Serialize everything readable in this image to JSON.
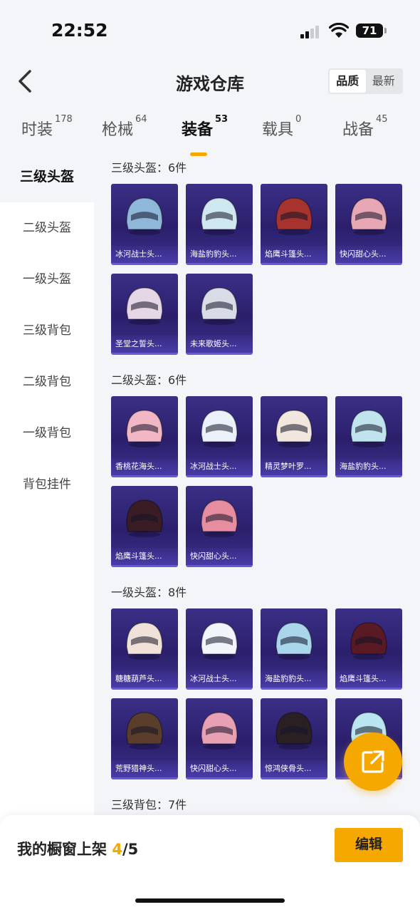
{
  "status_bar": {
    "time": "22:52",
    "battery": "71"
  },
  "header": {
    "title": "游戏仓库",
    "sort_options": [
      "品质",
      "最新"
    ],
    "sort_selected": "品质"
  },
  "tabs": [
    {
      "label": "时装",
      "count": "178"
    },
    {
      "label": "枪械",
      "count": "64"
    },
    {
      "label": "装备",
      "count": "53"
    },
    {
      "label": "载具",
      "count": "0"
    },
    {
      "label": "战备",
      "count": "45"
    }
  ],
  "active_tab": "装备",
  "sidebar": {
    "items": [
      "三级头盔",
      "二级头盔",
      "一级头盔",
      "三级背包",
      "二级背包",
      "一级背包",
      "背包挂件"
    ],
    "active": "三级头盔"
  },
  "sections": [
    {
      "title": "三级头盔：6件",
      "items": [
        {
          "label": "冰河战士头...",
          "icon": "helmet-icon",
          "color": "#8fb7d9"
        },
        {
          "label": "海盐豹豹头...",
          "icon": "helmet-icon",
          "color": "#cfe8f0"
        },
        {
          "label": "焰鹰斗篷头...",
          "icon": "helmet-icon",
          "color": "#a7332e"
        },
        {
          "label": "快闪甜心头...",
          "icon": "helmet-icon",
          "color": "#e8a7b5"
        },
        {
          "label": "圣堂之誓头...",
          "icon": "helmet-icon",
          "color": "#e6d7e6"
        },
        {
          "label": "未来歌姬头...",
          "icon": "helmet-icon",
          "color": "#d8dce6"
        }
      ]
    },
    {
      "title": "二级头盔：6件",
      "items": [
        {
          "label": "香桃花海头...",
          "icon": "helmet-icon",
          "color": "#f2b7c4"
        },
        {
          "label": "冰河战士头...",
          "icon": "helmet-icon",
          "color": "#eaf1f8"
        },
        {
          "label": "精灵梦叶罗...",
          "icon": "helmet-icon",
          "color": "#f1e7de"
        },
        {
          "label": "海盐豹豹头...",
          "icon": "helmet-icon",
          "color": "#bfe4ee"
        },
        {
          "label": "焰鹰斗篷头...",
          "icon": "helmet-icon",
          "color": "#3a1c24"
        },
        {
          "label": "快闪甜心头...",
          "icon": "helmet-icon",
          "color": "#e68da0"
        }
      ]
    },
    {
      "title": "一级头盔：8件",
      "items": [
        {
          "label": "糖糖葫芦头...",
          "icon": "helmet-icon",
          "color": "#f0e2d8"
        },
        {
          "label": "冰河战士头...",
          "icon": "helmet-icon",
          "color": "#f1f4fa"
        },
        {
          "label": "海盐豹豹头...",
          "icon": "helmet-icon",
          "color": "#a9d6ea"
        },
        {
          "label": "焰鹰斗篷头...",
          "icon": "helmet-icon",
          "color": "#5a1a24"
        },
        {
          "label": "荒野猎神头...",
          "icon": "helmet-icon",
          "color": "#5a3e2b"
        },
        {
          "label": "快闪甜心头...",
          "icon": "helmet-icon",
          "color": "#e8a0b4"
        },
        {
          "label": "惊鸿侠骨头...",
          "icon": "helmet-icon",
          "color": "#2a2024"
        },
        {
          "label": "",
          "icon": "helmet-icon",
          "color": "#b9e6f0"
        }
      ]
    },
    {
      "title": "三级背包：7件",
      "items": [
        {
          "label": "",
          "icon": "backpack-icon",
          "color": "#6b2020"
        },
        {
          "label": "",
          "icon": "backpack-icon",
          "color": "#9aa9c0"
        },
        {
          "label": "",
          "icon": "backpack-icon",
          "color": "#8a2020"
        },
        {
          "label": "",
          "icon": "backpack-icon",
          "color": "#d8c0c8"
        }
      ]
    }
  ],
  "bottom_bar": {
    "showcase_label": "我的橱窗上架",
    "showcase_current": "4",
    "showcase_total": "/5",
    "edit_label": "编辑"
  },
  "colors": {
    "accent": "#f5a800",
    "card_bg": "#2b1f6c"
  }
}
